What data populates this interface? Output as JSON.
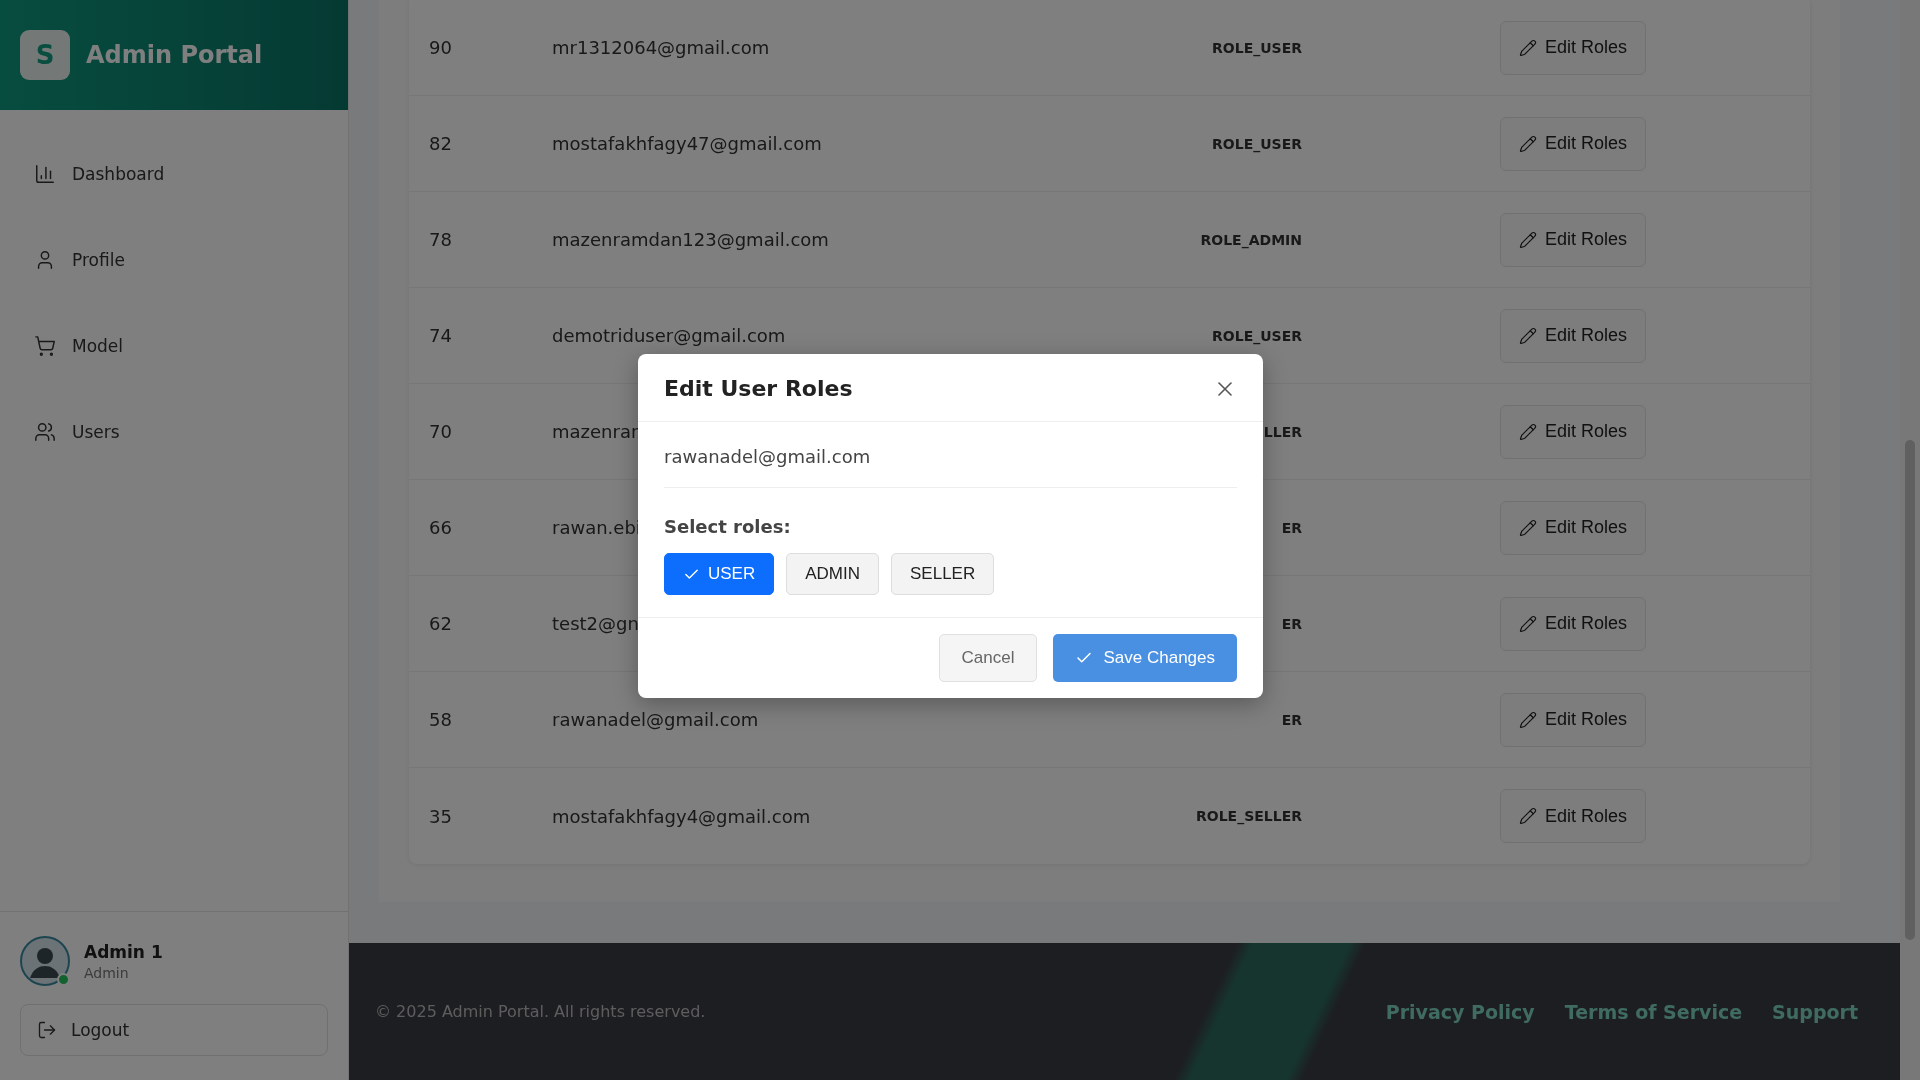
{
  "sidebar": {
    "logo_letter": "S",
    "title": "Admin Portal",
    "items": [
      {
        "label": "Dashboard",
        "selected": false
      },
      {
        "label": "Profile",
        "selected": false
      },
      {
        "label": "Model",
        "selected": false
      },
      {
        "label": "Users",
        "selected": false
      }
    ],
    "user": {
      "name": "Admin 1",
      "role": "Admin",
      "online": true
    },
    "logout": "Logout"
  },
  "table": {
    "rows": [
      {
        "id": "90",
        "email": "mr1312064@gmail.com",
        "role": "ROLE_USER",
        "action": "Edit Roles"
      },
      {
        "id": "82",
        "email": "mostafakhfagy47@gmail.com",
        "role": "ROLE_USER",
        "action": "Edit Roles"
      },
      {
        "id": "78",
        "email": "mazenramdan123@gmail.com",
        "role": "ROLE_ADMIN",
        "action": "Edit Roles"
      },
      {
        "id": "74",
        "email": "demotriduser@gmail.com",
        "role": "ROLE_USER",
        "action": "Edit Roles"
      },
      {
        "id": "70",
        "email": "mazenran",
        "role": "LLER",
        "action": "Edit Roles"
      },
      {
        "id": "66",
        "email": "rawan.ebi",
        "role": "ER",
        "action": "Edit Roles"
      },
      {
        "id": "62",
        "email": "test2@gn",
        "role": "ER",
        "action": "Edit Roles"
      },
      {
        "id": "58",
        "email": "rawanadel@gmail.com",
        "role": "ER",
        "action": "Edit Roles"
      },
      {
        "id": "35",
        "email": "mostafakhfagy4@gmail.com",
        "role": "ROLE_SELLER",
        "action": "Edit Roles"
      }
    ]
  },
  "footer": {
    "copyright": "© 2025 Admin Portal. All rights reserved.",
    "links": [
      "Privacy Policy",
      "Terms of Service",
      "Support"
    ]
  },
  "dialog": {
    "title": "Edit User Roles",
    "email": "rawanadel@gmail.com",
    "prompt": "Select roles:",
    "roles": [
      {
        "label": "USER",
        "selected": true
      },
      {
        "label": "ADMIN",
        "selected": false
      },
      {
        "label": "SELLER",
        "selected": false
      }
    ],
    "cancel": "Cancel",
    "save": "Save Changes"
  }
}
